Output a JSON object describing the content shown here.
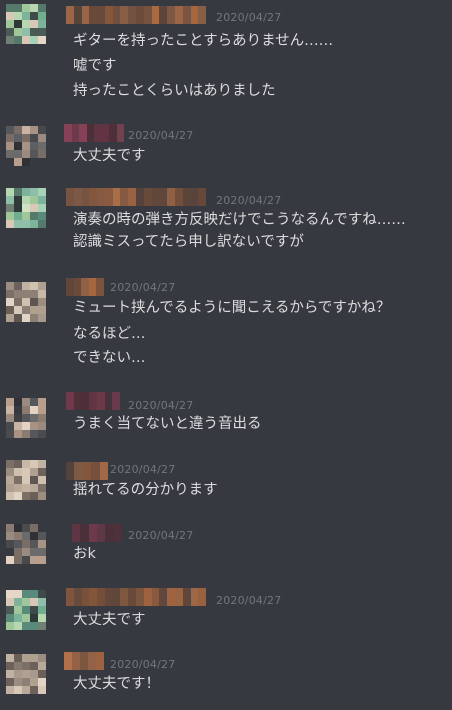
{
  "colors": {
    "background": "#36393f",
    "text": "#dcddde",
    "timestamp": "#72767d"
  },
  "messages": [
    {
      "avatar": "green-mosaic",
      "name_color": "orange-blurred",
      "timestamp": "2020/04/27",
      "lines": [
        "ギターを持ったことすらありません……",
        "嘘です",
        "持ったことくらいはありました"
      ]
    },
    {
      "avatar": "grey-mosaic",
      "name_color": "pink-blurred",
      "timestamp": "2020/04/27",
      "lines": [
        "大丈夫です"
      ]
    },
    {
      "avatar": "green-mosaic",
      "name_color": "orange-blurred",
      "timestamp": "2020/04/27",
      "lines": [
        "演奏の時の弾き方反映だけでこうなるんですね……",
        "認識ミスってたら申し訳ないですが"
      ]
    },
    {
      "avatar": "beige-mosaic",
      "name_color": "orange-blurred",
      "timestamp": "2020/04/27",
      "lines": [
        "ミュート挟んでるように聞こえるからですかね？",
        "なるほど…",
        "できない…"
      ]
    },
    {
      "avatar": "grey-mosaic",
      "name_color": "pink-blurred",
      "timestamp": "2020/04/27",
      "lines": [
        "うまく当てないと違う音出る"
      ]
    },
    {
      "avatar": "beige-mosaic",
      "name_color": "orange-blurred",
      "timestamp": "2020/04/27",
      "lines": [
        "揺れてるの分かります"
      ]
    },
    {
      "avatar": "grey-mosaic",
      "name_color": "pink-blurred",
      "timestamp": "2020/04/27",
      "lines": [
        "おk"
      ]
    },
    {
      "avatar": "green-mosaic",
      "name_color": "orange-blurred",
      "timestamp": "2020/04/27",
      "lines": [
        "大丈夫です"
      ]
    },
    {
      "avatar": "beige-mosaic",
      "name_color": "orange-blurred",
      "timestamp": "2020/04/27",
      "lines": [
        "大丈夫です！"
      ]
    }
  ]
}
